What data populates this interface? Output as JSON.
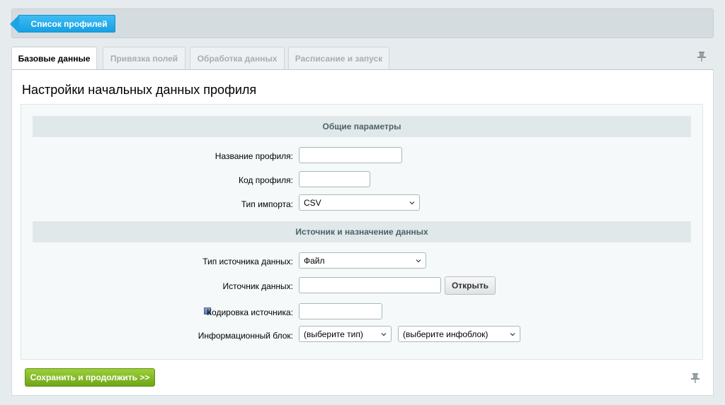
{
  "header": {
    "back_label": "Список профилей"
  },
  "tabs": [
    {
      "label": "Базовые данные",
      "active": true
    },
    {
      "label": "Привязка полей",
      "active": false
    },
    {
      "label": "Обработка данных",
      "active": false
    },
    {
      "label": "Расписание и запуск",
      "active": false
    }
  ],
  "page": {
    "title": "Настройки начальных данных профиля"
  },
  "sections": {
    "general": "Общие параметры",
    "source": "Источник и назначение данных"
  },
  "fields": {
    "profile_name": {
      "label": "Название профиля:",
      "value": ""
    },
    "profile_code": {
      "label": "Код профиля:",
      "value": ""
    },
    "import_type": {
      "label": "Тип импорта:",
      "value": "CSV"
    },
    "source_type": {
      "label": "Тип источника данных:",
      "value": "Файл"
    },
    "data_source": {
      "label": "Источник данных:",
      "value": "",
      "button": "Открыть"
    },
    "encoding": {
      "label": "Кодировка источника:",
      "value": ""
    },
    "iblock": {
      "label": "Информационный блок:",
      "type_value": "(выберите тип)",
      "iblock_value": "(выберите инфоблок)"
    }
  },
  "actions": {
    "save_label": "Сохранить и продолжить >>"
  },
  "colors": {
    "accent_blue": "#17a0e3",
    "save_green": "#7cb518",
    "section_bg": "#e0e8ea"
  },
  "icons": {
    "pin": "pin-icon",
    "help": "help-icon",
    "dropdown": "chevron-down-icon"
  }
}
